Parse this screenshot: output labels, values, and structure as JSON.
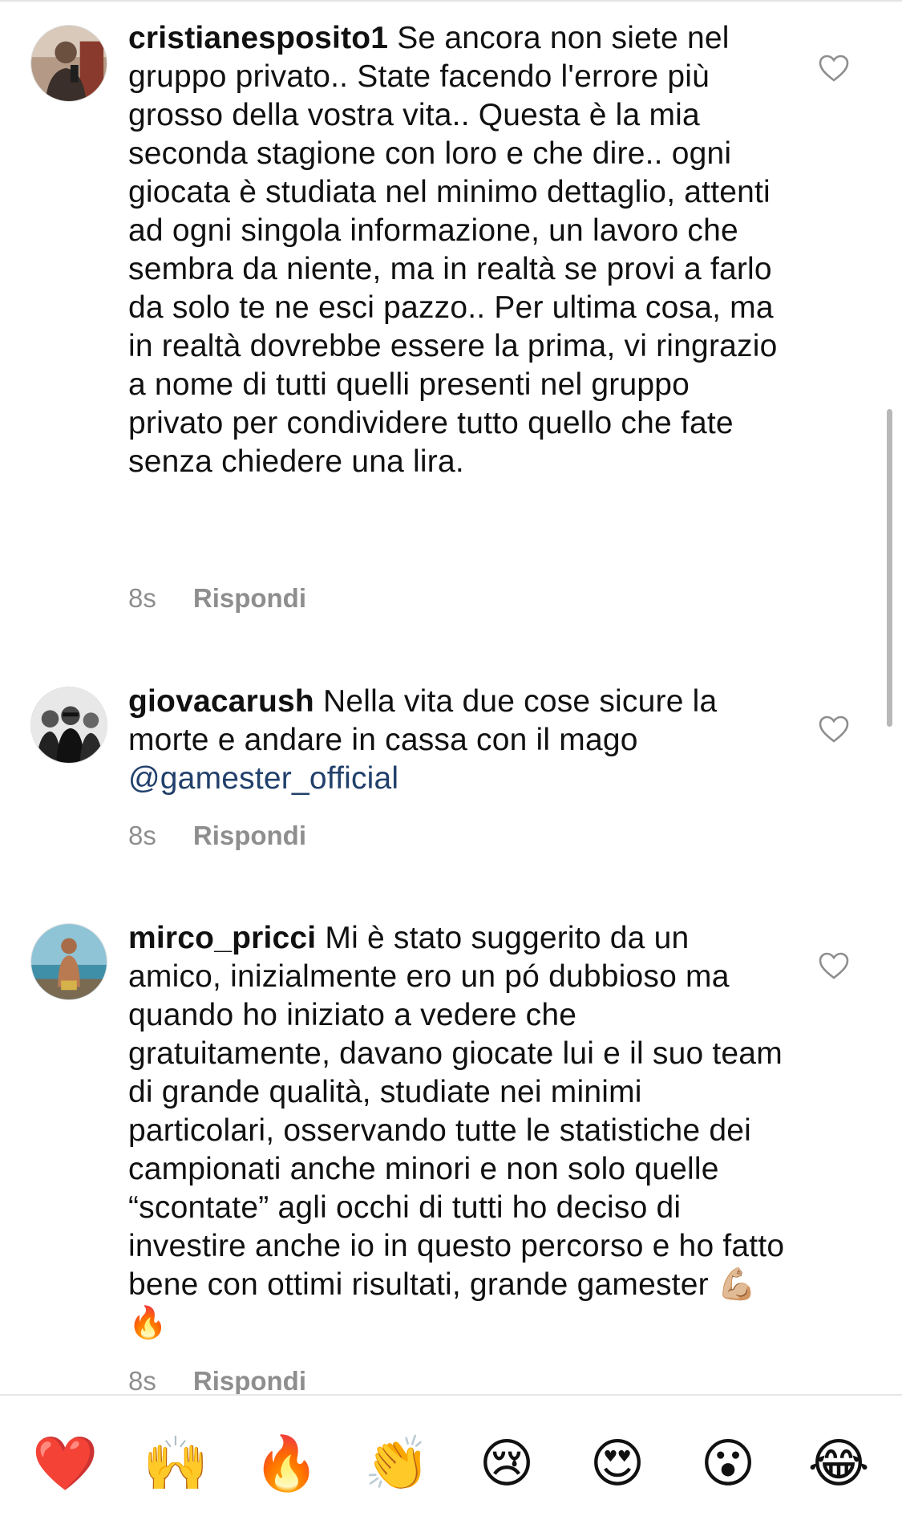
{
  "comments": [
    {
      "username": "cristianesposito1",
      "text": " Se ancora non siete nel gruppo privato.. State facendo l'errore più grosso della vostra vita.. Questa è la mia seconda stagione con loro e che dire.. ogni giocata è studiata nel minimo dettaglio, attenti ad ogni singola informazione, un lavoro che sembra da niente, ma in realtà se provi a farlo da solo te ne esci pazzo.. Per ultima cosa, ma in realtà dovrebbe essere la prima, vi ringrazio a nome di tutti quelli presenti nel gruppo privato per condividere tutto quello che fate senza chiedere una lira.",
      "time": "8s",
      "reply_label": "Rispondi"
    },
    {
      "username": "giovacarush",
      "text": " Nella vita due cose sicure la morte e andare in cassa con il mago ",
      "mention": "@gamester_official",
      "time": "8s",
      "reply_label": "Rispondi"
    },
    {
      "username": "mirco_pricci",
      "text": " Mi è stato suggerito da un amico, inizialmente ero un pó dubbioso ma quando ho iniziato a vedere che gratuitamente, davano giocate lui e il suo team di grande qualità, studiate nei minimi particolari, osservando tutte le statistiche dei campionati anche minori e non solo quelle “scontate” agli occhi di tutti ho deciso di investire anche io in questo percorso e ho fatto bene con ottimi risultati, grande gamester 💪🏼🔥",
      "time": "8s",
      "reply_label": "Rispondi"
    }
  ],
  "emoji_bar": [
    "❤️",
    "🙌",
    "🔥",
    "👏",
    "😢",
    "😍",
    "😮",
    "😂"
  ],
  "colors": {
    "text": "#111111",
    "meta": "#8e8e8e",
    "mention": "#21406b",
    "scrollbar": "#b8b8b8"
  }
}
